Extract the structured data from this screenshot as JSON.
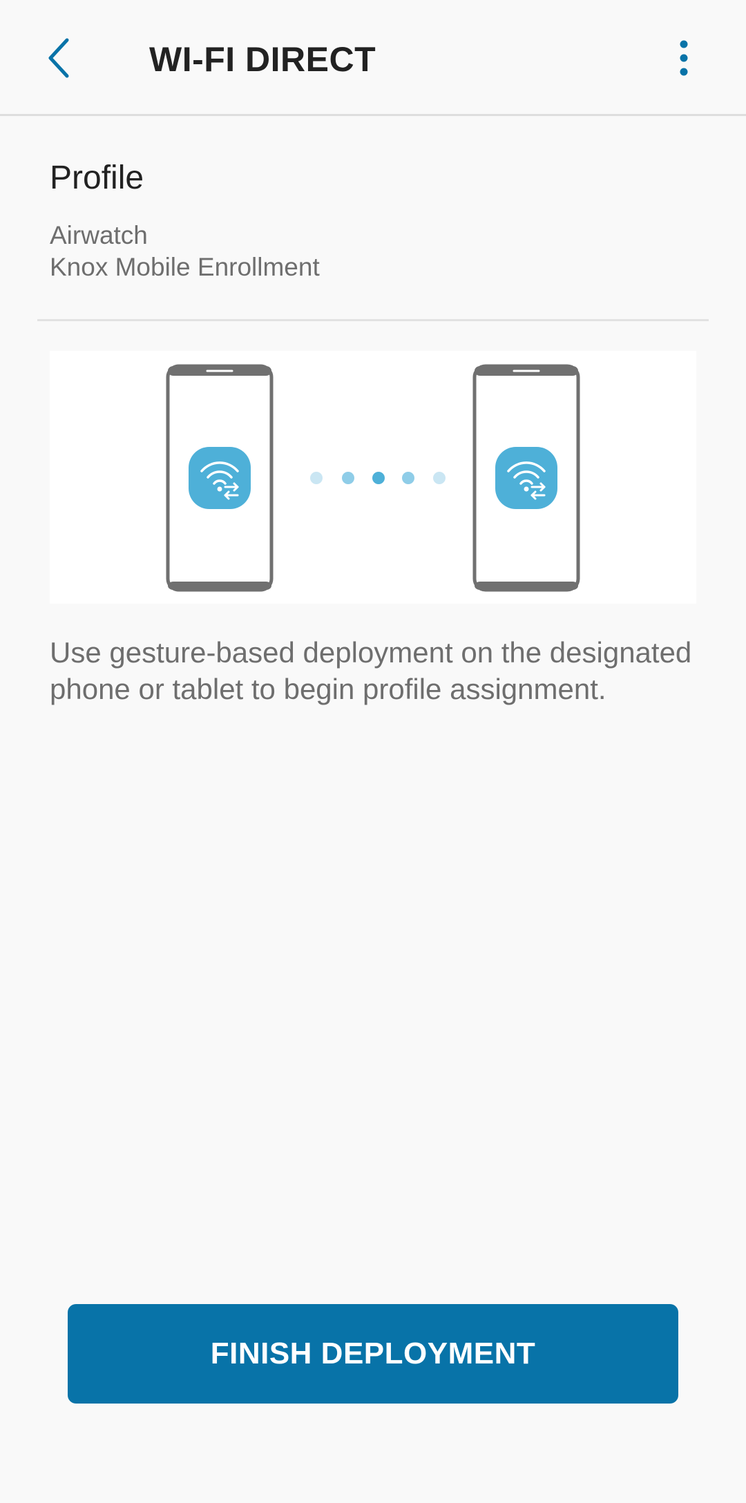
{
  "header": {
    "title": "WI-FI DIRECT",
    "back_icon": "chevron-left-icon",
    "more_icon": "more-vertical-icon"
  },
  "profile": {
    "heading": "Profile",
    "lines": [
      "Airwatch",
      "Knox Mobile Enrollment"
    ]
  },
  "illustration": {
    "device_icon": "wifi-direct-icon"
  },
  "description": "Use gesture-based deployment on the designated phone or tablet to begin profile assignment.",
  "actions": {
    "finish_label": "FINISH DEPLOYMENT"
  },
  "colors": {
    "accent": "#0873a8",
    "wifi_badge": "#4eb0d8",
    "phone_frame": "#707070"
  }
}
